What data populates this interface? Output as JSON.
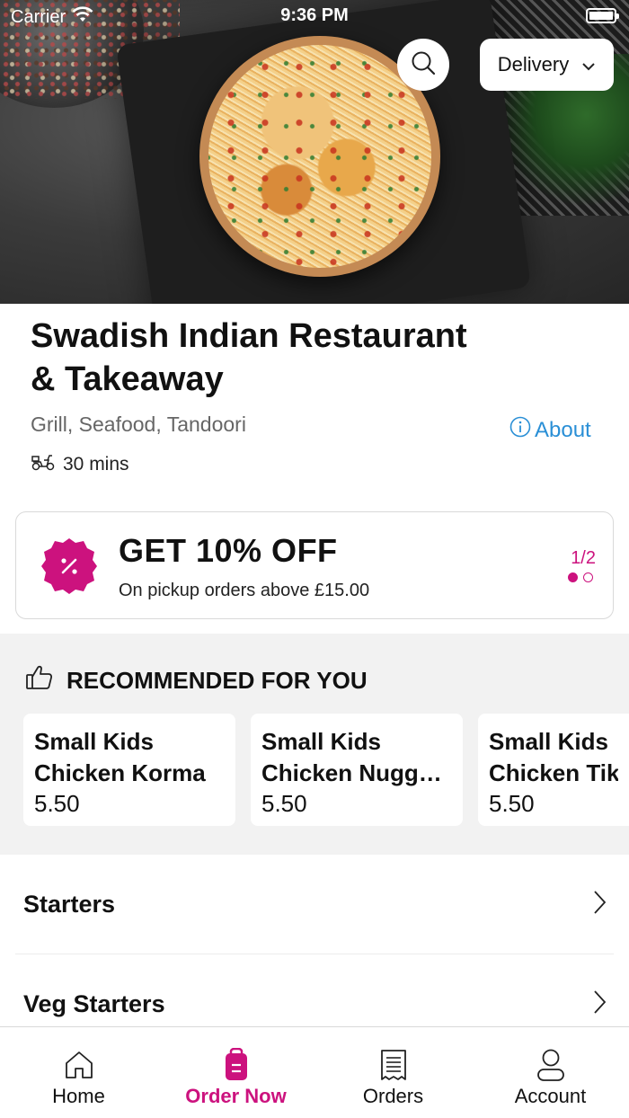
{
  "status_bar": {
    "carrier": "Carrier",
    "time": "9:36 PM"
  },
  "header": {
    "delivery_mode": "Delivery"
  },
  "restaurant": {
    "name": "Swadish Indian Restaurant & Takeaway",
    "cuisines": "Grill, Seafood, Tandoori",
    "about_label": "About",
    "delivery_time": "30 mins"
  },
  "promo": {
    "headline": "GET 10% OFF",
    "subtitle": "On pickup orders above £15.00",
    "pager": "1/2"
  },
  "recommended": {
    "heading": "RECOMMENDED FOR YOU",
    "items": [
      {
        "line1": "Small Kids",
        "line2": "Chicken Korma",
        "price": "5.50"
      },
      {
        "line1": "Small Kids",
        "line2": "Chicken Nuggets",
        "price": "5.50"
      },
      {
        "line1": "Small Kids",
        "line2": "Chicken Tikka",
        "price": "5.50"
      }
    ]
  },
  "categories": [
    {
      "label": "Starters"
    },
    {
      "label": "Veg Starters"
    }
  ],
  "tabbar": {
    "tabs": [
      {
        "label": "Home"
      },
      {
        "label": "Order Now"
      },
      {
        "label": "Orders"
      },
      {
        "label": "Account"
      }
    ],
    "active_color": "#cc127e"
  },
  "colors": {
    "accent": "#cc127e",
    "link": "#2a8fd6"
  },
  "icons": [
    "wifi-icon",
    "battery-icon",
    "search-icon",
    "chevron-down-icon",
    "info-icon",
    "delivery-scooter-icon",
    "discount-badge-icon",
    "thumbs-up-icon",
    "chevron-right-icon",
    "home-icon",
    "order-bag-icon",
    "receipt-icon",
    "account-icon"
  ]
}
